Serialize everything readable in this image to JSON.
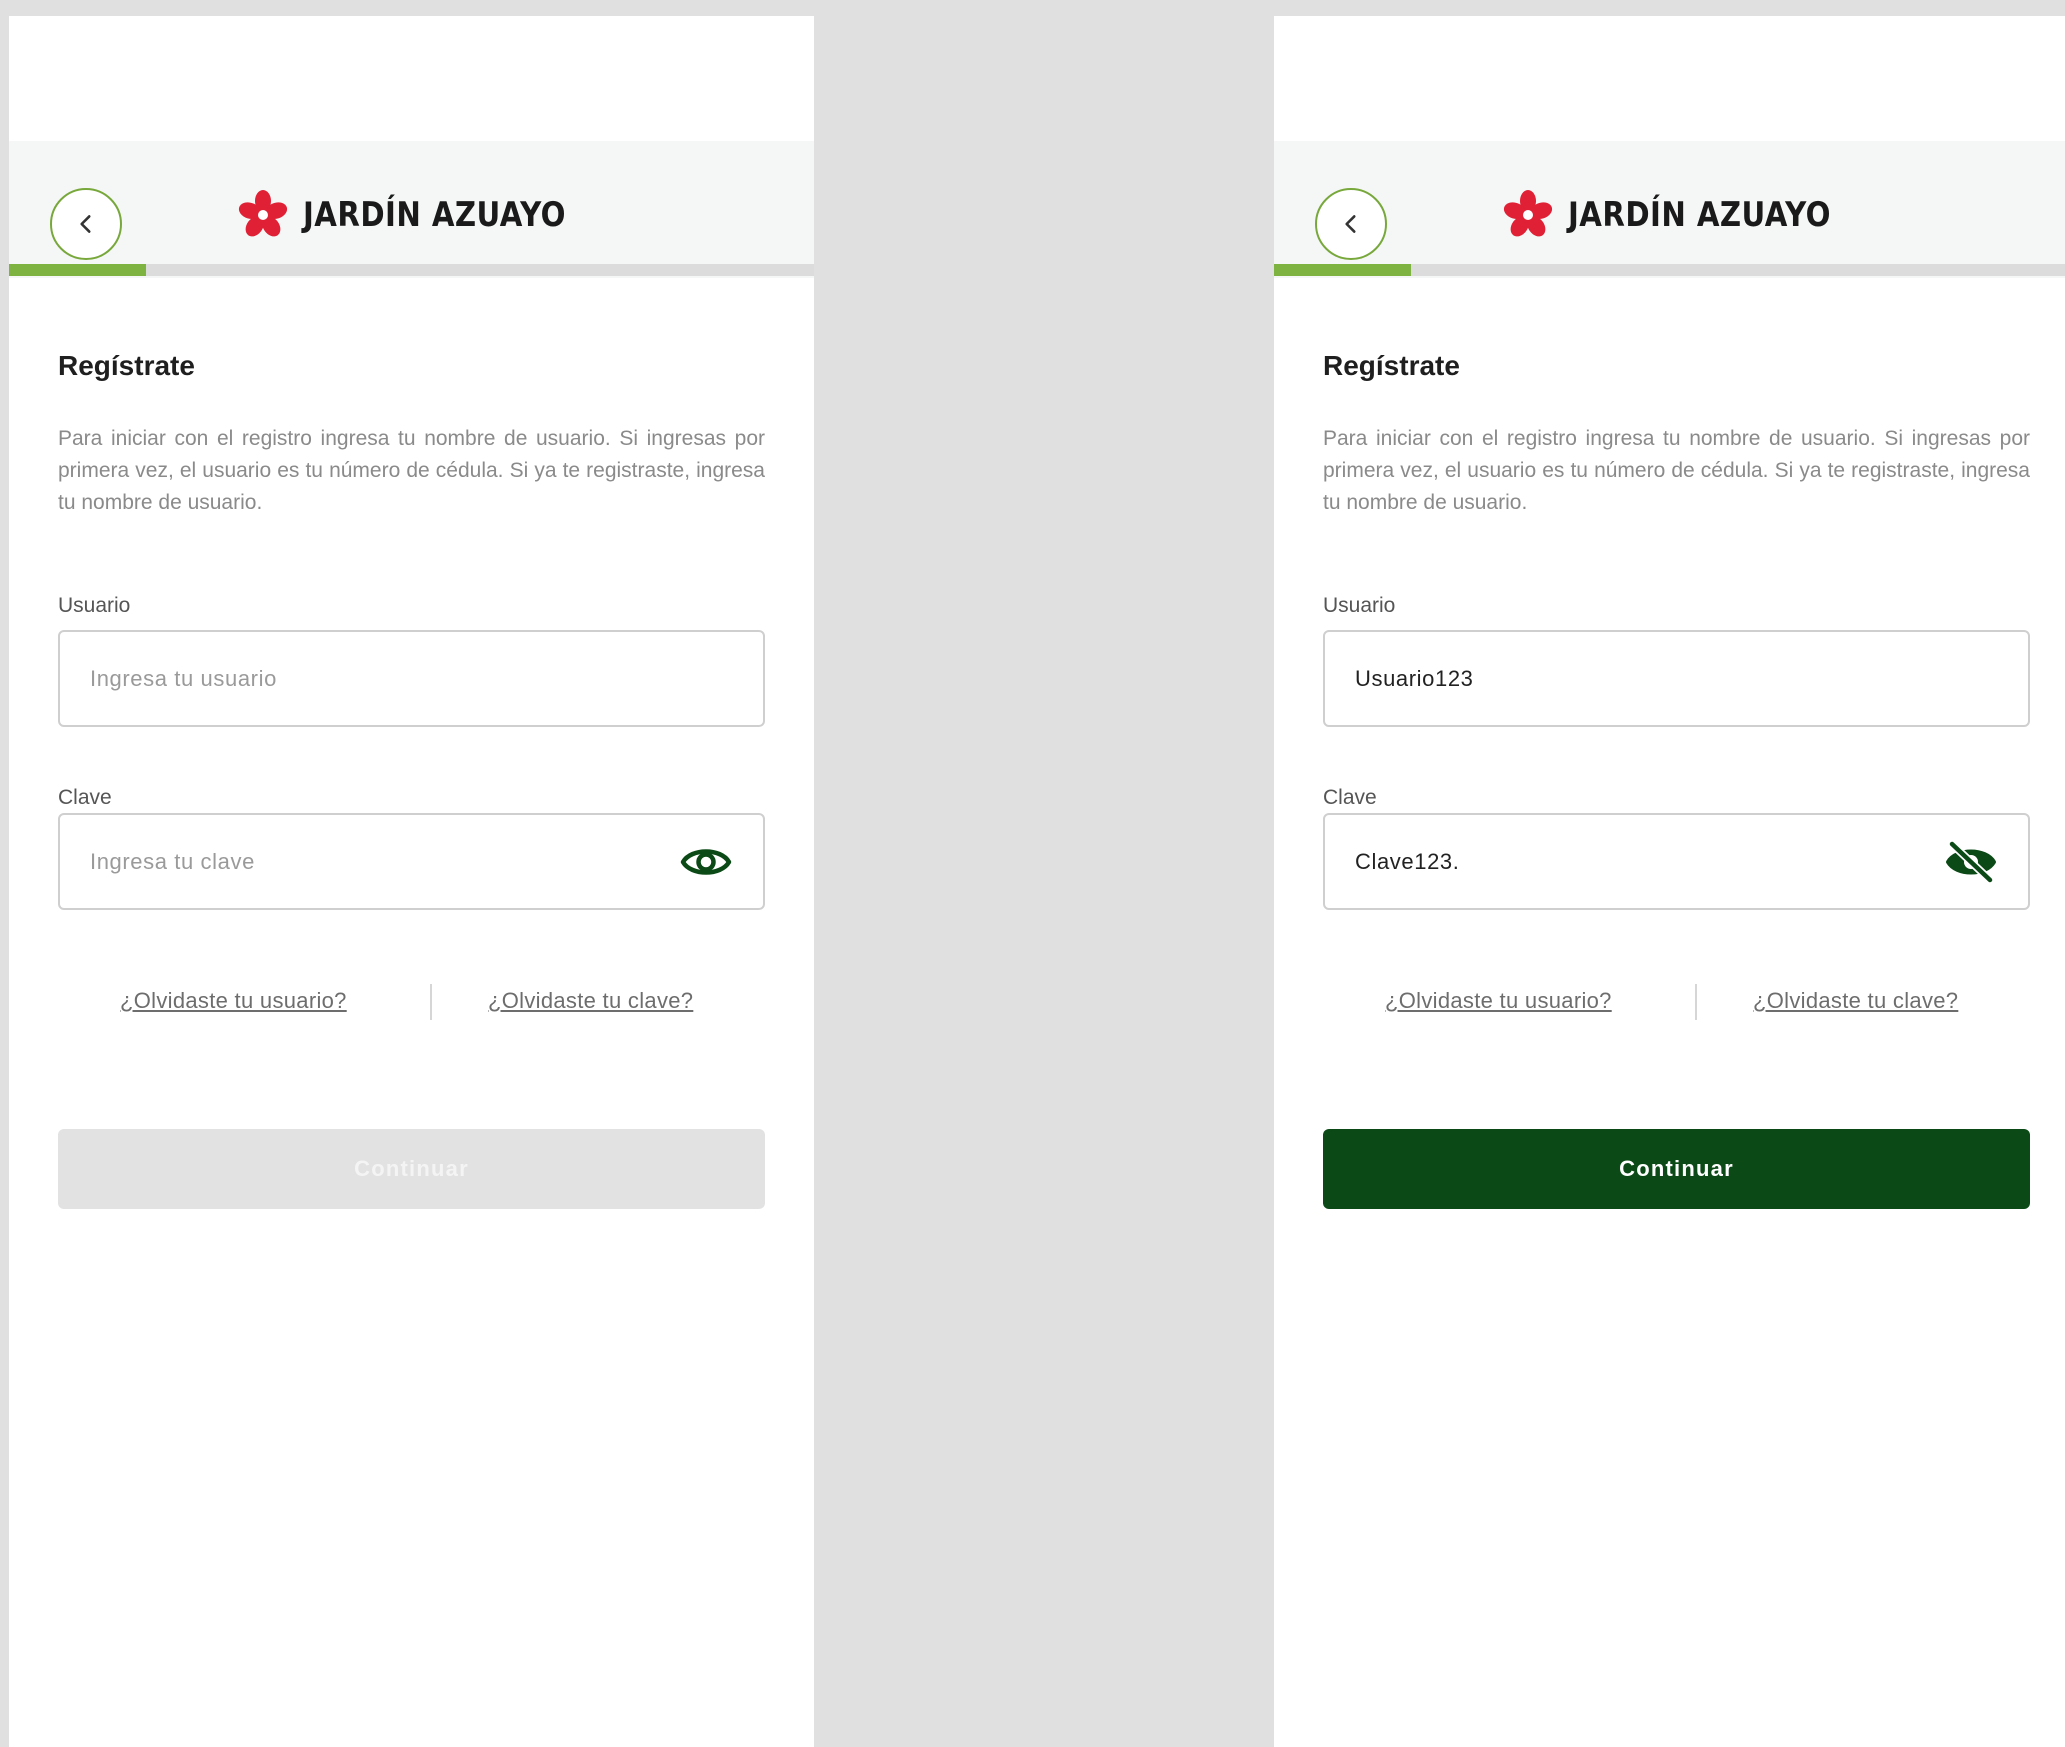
{
  "brand": {
    "name": "JARDÍN AZUAYO",
    "logo_icon": "red-flower-logo-icon",
    "accent_color": "#7fb341",
    "logo_color": "#e02035",
    "primary_color": "#0b4a16"
  },
  "screens": [
    {
      "state": "empty",
      "progress_percent": 17,
      "title": "Regístrate",
      "description": "Para iniciar con el registro ingresa tu nombre de usuario. Si ingresas por primera vez, el usuario es tu número de cédula. Si ya te registraste, ingresa tu nombre de usuario.",
      "user_label": "Usuario",
      "user_value": "",
      "user_placeholder": "Ingresa tu usuario",
      "pass_label": "Clave",
      "pass_value": "",
      "pass_placeholder": "Ingresa tu clave",
      "pass_icon": "eye-icon",
      "forgot_user": "¿Olvidaste tu usuario?",
      "forgot_pass": "¿Olvidaste tu clave?",
      "button_label": "Continuar",
      "button_state": "disabled"
    },
    {
      "state": "filled",
      "progress_percent": 17,
      "title": "Regístrate",
      "description": "Para iniciar con el registro ingresa tu nombre de usuario. Si ingresas por primera vez, el usuario es tu número de cédula. Si ya te registraste, ingresa tu nombre de usuario.",
      "user_label": "Usuario",
      "user_value": "Usuario123",
      "user_placeholder": "Ingresa tu usuario",
      "pass_label": "Clave",
      "pass_value": "Clave123.",
      "pass_placeholder": "Ingresa tu clave",
      "pass_icon": "eye-off-icon",
      "forgot_user": "¿Olvidaste tu usuario?",
      "forgot_pass": "¿Olvidaste tu clave?",
      "button_label": "Continuar",
      "button_state": "enabled"
    }
  ]
}
